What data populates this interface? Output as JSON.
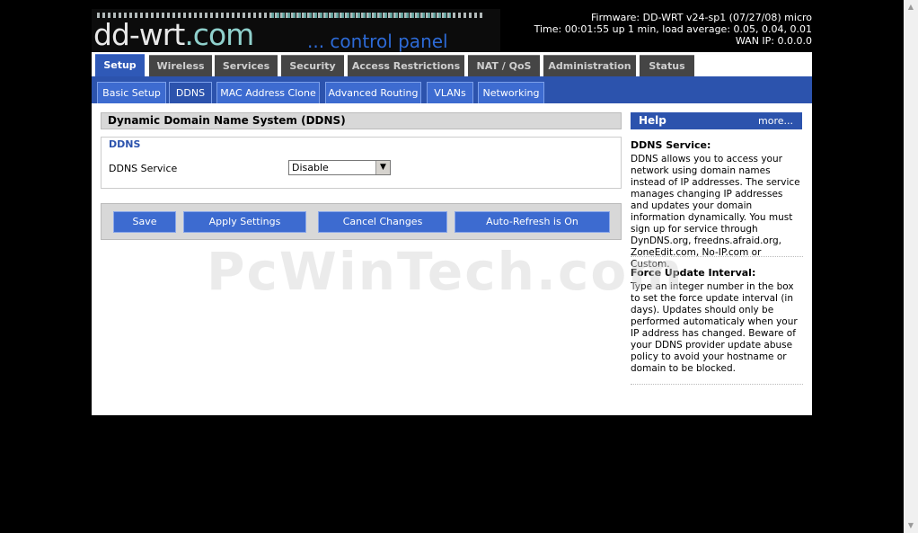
{
  "header": {
    "logo_main": "dd-wrt",
    "logo_dotcom": ".com",
    "logo_sub": "... control panel",
    "firmware": "Firmware: DD-WRT v24-sp1 (07/27/08) micro",
    "time": "Time: 00:01:55 up 1 min, load average: 0.05, 0.04, 0.01",
    "wan_ip": "WAN IP: 0.0.0.0"
  },
  "main_tabs": [
    "Setup",
    "Wireless",
    "Services",
    "Security",
    "Access Restrictions",
    "NAT / QoS",
    "Administration",
    "Status"
  ],
  "sub_tabs": [
    "Basic Setup",
    "DDNS",
    "MAC Address Clone",
    "Advanced Routing",
    "VLANs",
    "Networking"
  ],
  "content": {
    "section_title": "Dynamic Domain Name System (DDNS)",
    "legend": "DDNS",
    "ddns_service_label": "DDNS Service",
    "ddns_service_value": "Disable"
  },
  "buttons": {
    "save": "Save",
    "apply": "Apply Settings",
    "cancel": "Cancel Changes",
    "autorefresh": "Auto-Refresh is On"
  },
  "help": {
    "title": "Help",
    "more": "more...",
    "ddns_title": "DDNS Service:",
    "ddns_text": "DDNS allows you to access your network using domain names instead of IP addresses. The service manages changing IP addresses and updates your domain information dynamically. You must sign up for service through DynDNS.org, freedns.afraid.org, ZoneEdit.com, No-IP.com or Custom.",
    "force_title": "Force Update Interval:",
    "force_text": "Type an integer number in the box to set the force update interval (in days). Updates should only be performed automaticaly when your IP address has changed. Beware of your DDNS provider update abuse policy to avoid your hostname or domain to be blocked."
  },
  "watermark": "PcWinTech.com"
}
